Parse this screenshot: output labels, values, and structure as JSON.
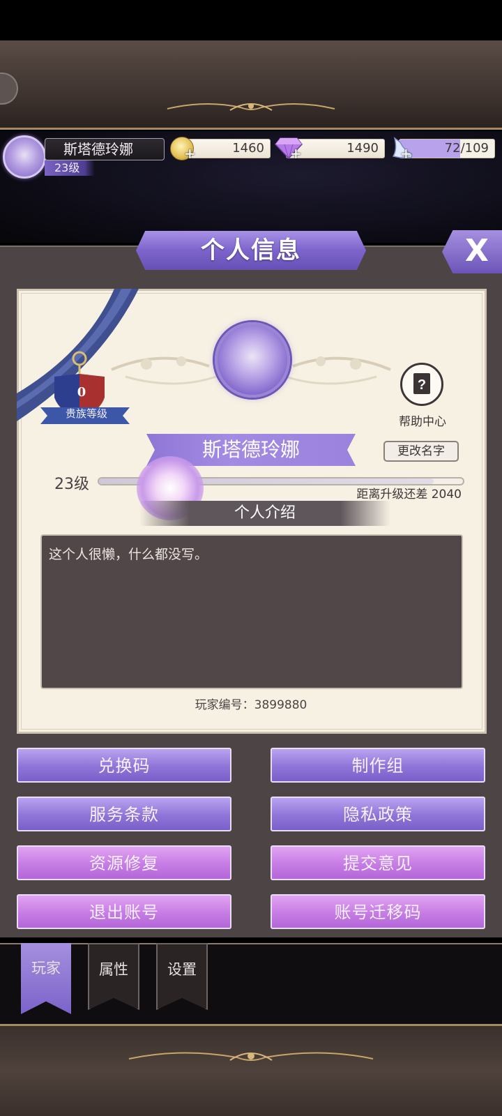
{
  "player": {
    "name": "斯塔德玲娜",
    "level": "23级"
  },
  "resources": {
    "gold": "1460",
    "gems": "1490",
    "energy": "72/109",
    "energy_fraction": 0.66
  },
  "panel": {
    "title": "个人信息",
    "close_label": "X"
  },
  "profile": {
    "noble_level": "0",
    "noble_label": "贵族等级",
    "help_label": "帮助中心",
    "name": "斯塔德玲娜",
    "rename_label": "更改名字",
    "level": "23级",
    "xp_fraction": 0.92,
    "xp_remaining": "距离升级还差 2040",
    "intro_header": "个人介绍",
    "intro_text": "这个人很懒，什么都没写。",
    "player_id": "玩家编号：3899880"
  },
  "buttons": {
    "redeem_code": "兑换码",
    "credits": "制作组",
    "terms": "服务条款",
    "privacy": "隐私政策",
    "repair": "资源修复",
    "feedback": "提交意见",
    "logout": "退出账号",
    "transfer_code": "账号迁移码"
  },
  "tabs": [
    {
      "label": "玩家",
      "active": true
    },
    {
      "label": "属性",
      "active": false
    },
    {
      "label": "设置",
      "active": false
    }
  ],
  "colors": {
    "accent_lavender": "#8f74d8",
    "accent_pink": "#c67ce4",
    "panel_bg": "#4d4446",
    "card_bg": "#f7f1e4"
  }
}
